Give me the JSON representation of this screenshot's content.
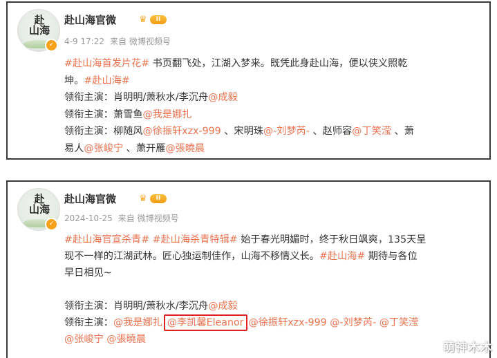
{
  "post1": {
    "account_name": "赴山海官微",
    "level_label": "II",
    "timestamp": "4-9 17:22",
    "source": "来自 微博视频号",
    "line1": {
      "tag1": "#赴山海首发片花#",
      "text": " 书页翻飞处，江湖入梦来。既凭此身赴山海，便以侠义照乾"
    },
    "line2": {
      "text": "坤。",
      "tag2": "#赴山海#"
    },
    "line3": {
      "label": "领衔主演：肖明明/萧秋水/李沉舟",
      "mention": "@成毅"
    },
    "line4": {
      "label": "领衔主演：萧雪鱼",
      "mention": "@我是娜扎"
    },
    "line5": {
      "label": "领衔主演：柳随风",
      "m1": "@徐振轩xzx-999",
      "t1": " 、宋明珠",
      "m2": "@-刘梦芮-",
      "t2": " 、赵师容",
      "m3": "@丁笑滢",
      "t3": " 、萧"
    },
    "line6": {
      "t1": "易人",
      "m1": "@张峻宁",
      "t2": " 、萧开雁",
      "m2": "@張曉晨"
    }
  },
  "post2": {
    "account_name": "赴山海官微",
    "level_label": "II",
    "timestamp": "2024-10-25",
    "source": "来自 微博视频号",
    "line1": {
      "tag1": "#赴山海官宣杀青#",
      "tag2": " #赴山海杀青特辑#",
      "text": " 始于春光明媚时，终于秋日飒爽，135天呈"
    },
    "line2": {
      "text": "现不一样的江湖武林。匠心独运制佳作，山海不移情义长。",
      "tag3": "#赴山海#",
      "text2": " 期待与各位"
    },
    "line3": {
      "text": "早日相见~"
    },
    "line4": {
      "label": "领衔主演：肖明明/萧秋水/李沉舟",
      "mention": "@成毅"
    },
    "line5": {
      "label": "领衔主演：",
      "m1": "@我是娜扎",
      "m2": "@李凯馨Eleanor",
      "m3": "@徐振轩xzx-999",
      "m4": "@-刘梦芮-",
      "m5": "@丁笑滢"
    },
    "line6": {
      "m1": "@张峻宁",
      "m2": "@張曉晨"
    }
  },
  "watermark": "萌神木木",
  "colors": {
    "accent": "#eb7350",
    "highlight_box": "#e02020",
    "verified": "#f7a11a"
  }
}
